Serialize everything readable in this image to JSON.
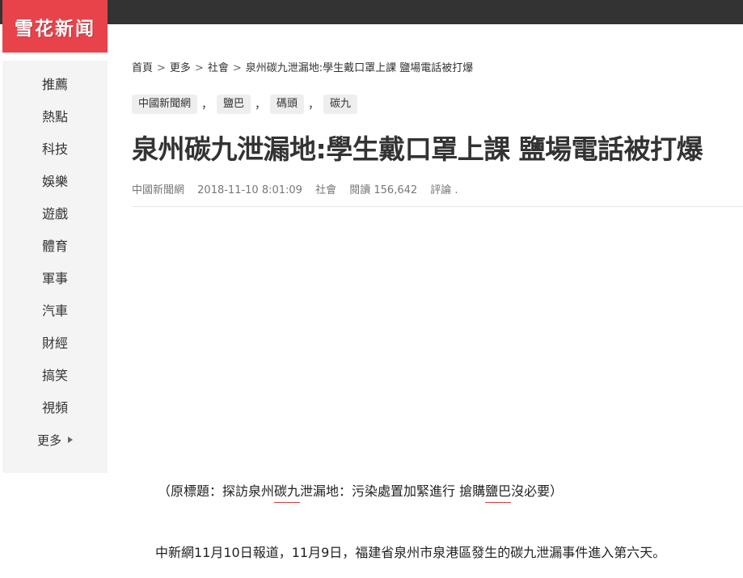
{
  "header": {
    "logo_text": "雪花新闻",
    "brand_color": "#e8434b",
    "bar_color": "#333333"
  },
  "sidebar": {
    "items": [
      {
        "label": "推薦"
      },
      {
        "label": "熱點"
      },
      {
        "label": "科技"
      },
      {
        "label": "娛樂"
      },
      {
        "label": "遊戲"
      },
      {
        "label": "體育"
      },
      {
        "label": "軍事"
      },
      {
        "label": "汽車"
      },
      {
        "label": "財經"
      },
      {
        "label": "搞笑"
      },
      {
        "label": "視頻"
      }
    ],
    "more_label": "更多"
  },
  "breadcrumb": {
    "items": [
      "首頁",
      "更多",
      "社會",
      "泉州碳九泄漏地:學生戴口罩上課 鹽場電話被打爆"
    ],
    "separator": ">"
  },
  "tags": [
    "中國新聞網",
    "鹽巴",
    "碼頭",
    "碳九"
  ],
  "tag_separator": "，",
  "article": {
    "title": "泉州碳九泄漏地:學生戴口罩上課 鹽場電話被打爆",
    "meta": {
      "source": "中國新聞網",
      "datetime": "2018-11-10 8:01:09",
      "category": "社會",
      "views_label": "閱讀 156,642",
      "comments_label": "評論 ."
    },
    "para1": {
      "p1": "（原標題：探訪泉州",
      "k1": "碳九",
      "p2": "泄漏地：污染處置加緊進行 搶購",
      "k2": "鹽巴",
      "p3": "沒必要）"
    },
    "para2": "中新網11月10日報道，11月9日，福建省泉州市泉港區發生的碳九泄漏事件進入第六天。"
  }
}
